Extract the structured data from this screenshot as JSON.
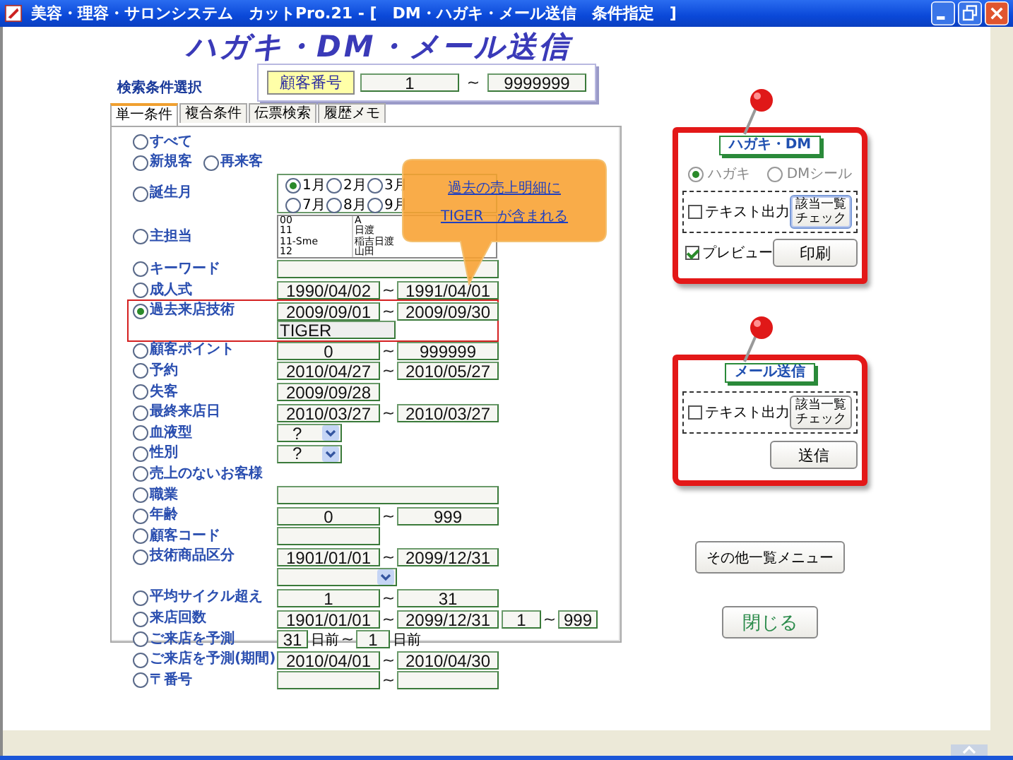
{
  "window": {
    "title": "美容・理容・サロンシステム　カットPro.21 - [　DM・ハガキ・メール送信　条件指定　]"
  },
  "heading": "ハガキ・DM・メール送信",
  "customer_number": {
    "label": "顧客番号",
    "from": "1",
    "tilde": "~",
    "to": "9999999"
  },
  "search_label": "検索条件選択",
  "tabs": [
    {
      "label": "単一条件",
      "selected": true
    },
    {
      "label": "複合条件",
      "selected": false
    },
    {
      "label": "伝票検索",
      "selected": false
    },
    {
      "label": "履歴メモ",
      "selected": false
    }
  ],
  "callout": {
    "lines": [
      "過去の売上明細に",
      "TIGER　が含まれる"
    ]
  },
  "rows": [
    {
      "kind": "plain",
      "label": "すべて",
      "selected": false
    },
    {
      "kind": "pair",
      "label": "新規客",
      "selected": false,
      "second": {
        "label": "再来客",
        "selected": false
      }
    },
    {
      "kind": "months",
      "label": "誕生月",
      "selected": false,
      "months": [
        {
          "label": "1月",
          "selected": true
        },
        {
          "label": "2月",
          "selected": false
        },
        {
          "label": "3月",
          "selected": false
        },
        {
          "label": "7月",
          "selected": false
        },
        {
          "label": "8月",
          "selected": false
        },
        {
          "label": "9月",
          "selected": false
        }
      ]
    },
    {
      "kind": "staff",
      "label": "主担当",
      "selected": false,
      "codes": [
        "00",
        "11",
        "11-Sme",
        "12"
      ],
      "names": [
        "A",
        "日渡",
        "稲吉日渡",
        "山田"
      ]
    },
    {
      "kind": "wide",
      "label": "キーワード",
      "selected": false
    },
    {
      "kind": "range",
      "label": "成人式",
      "selected": false,
      "from": "1990/04/02",
      "tilde": "~",
      "to": "1991/04/01"
    },
    {
      "kind": "range",
      "label": "過去来店技術",
      "selected": true,
      "highlighted": true,
      "from": "2009/09/01",
      "tilde": "~",
      "to": "2009/09/30",
      "extra": "TIGER"
    },
    {
      "kind": "range",
      "label": "顧客ポイント",
      "selected": false,
      "from": "0",
      "tilde": "~",
      "to": "999999"
    },
    {
      "kind": "range",
      "label": "予約",
      "selected": false,
      "from": "2010/04/27",
      "tilde": "~",
      "to": "2010/05/27"
    },
    {
      "kind": "single",
      "label": "失客",
      "selected": false,
      "value": "2009/09/28"
    },
    {
      "kind": "range",
      "label": "最終来店日",
      "selected": false,
      "from": "2010/03/27",
      "tilde": "~",
      "to": "2010/03/27"
    },
    {
      "kind": "select",
      "label": "血液型",
      "selected": false,
      "value": "?"
    },
    {
      "kind": "select",
      "label": "性別",
      "selected": false,
      "value": "?"
    },
    {
      "kind": "plain",
      "label": "売上のないお客様",
      "selected": false
    },
    {
      "kind": "wide",
      "label": "職業",
      "selected": false
    },
    {
      "kind": "range",
      "label": "年齢",
      "selected": false,
      "from": "0",
      "tilde": "~",
      "to": "999"
    },
    {
      "kind": "single",
      "label": "顧客コード",
      "selected": false
    },
    {
      "kind": "range",
      "label": "技術商品区分",
      "selected": false,
      "from": "1901/01/01",
      "tilde": "~",
      "to": "2099/12/31"
    },
    {
      "kind": "dropdown"
    },
    {
      "kind": "range",
      "label": "平均サイクル超え",
      "selected": false,
      "from": "1",
      "tilde": "~",
      "to": "31"
    },
    {
      "kind": "range4",
      "label": "来店回数",
      "selected": false,
      "from": "1901/01/01",
      "tilde": "~",
      "to": "2099/12/31",
      "from2": "1",
      "tilde2": "~",
      "to2": "999"
    },
    {
      "kind": "days",
      "label": "ご来店を予測",
      "selected": false,
      "from": "31",
      "unit": "日前",
      "tilde": "~",
      "to": "1",
      "unit2": "日前"
    },
    {
      "kind": "range",
      "label": "ご来店を予測(期間)",
      "selected": false,
      "from": "2010/04/01",
      "tilde": "~",
      "to": "2010/04/30"
    },
    {
      "kind": "range",
      "label": "〒番号",
      "selected": false,
      "tilde": "~"
    }
  ],
  "postcard": {
    "title": "ハガキ・DM",
    "options": [
      {
        "label": "ハガキ",
        "selected": true
      },
      {
        "label": "DMシール",
        "selected": false
      }
    ],
    "text_output": {
      "label": "テキスト出力",
      "checked": false
    },
    "check_button": [
      "該当一覧",
      "チェック"
    ],
    "preview": {
      "label": "プレビュー",
      "checked": true
    },
    "print_button": "印刷"
  },
  "mail": {
    "title": "メール送信",
    "text_output": {
      "label": "テキスト出力",
      "checked": false
    },
    "check_button": [
      "該当一覧",
      "チェック"
    ],
    "send_button": "送信"
  },
  "other_menu_button": "その他一覧メニュー",
  "close_button": "閉じる"
}
